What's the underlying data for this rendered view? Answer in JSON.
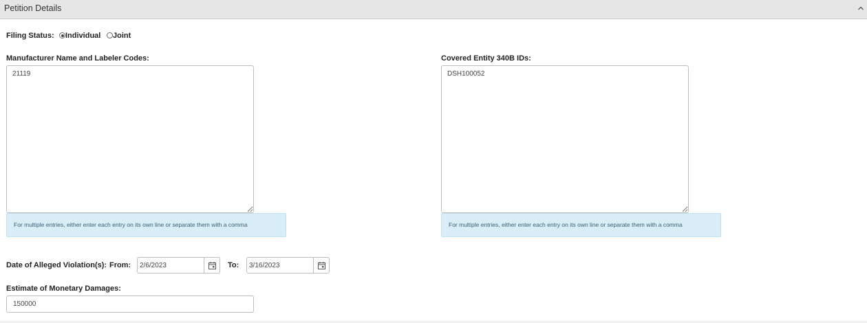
{
  "panel": {
    "title": "Petition Details",
    "collapse_icon": "chevron-up-icon"
  },
  "filing_status": {
    "label": "Filing Status:",
    "options": [
      {
        "label": "Individual",
        "checked": true
      },
      {
        "label": "Joint",
        "checked": false
      }
    ]
  },
  "manufacturer": {
    "label": "Manufacturer Name and Labeler Codes:",
    "value": "21119",
    "hint": "For multiple entries, either enter each entry on its own line or separate them with a comma"
  },
  "covered_entity": {
    "label": "Covered Entity 340B IDs:",
    "value": "DSH100052",
    "hint": "For multiple entries, either enter each entry on its own line or separate them with a comma"
  },
  "violation_dates": {
    "label": "Date of Alleged Violation(s):",
    "from_label": "From:",
    "from_value": "2/6/2023",
    "to_label": "To:",
    "to_value": "3/16/2023",
    "calendar_icon": "calendar-icon"
  },
  "damages": {
    "label": "Estimate of Monetary Damages:",
    "value": "150000"
  }
}
